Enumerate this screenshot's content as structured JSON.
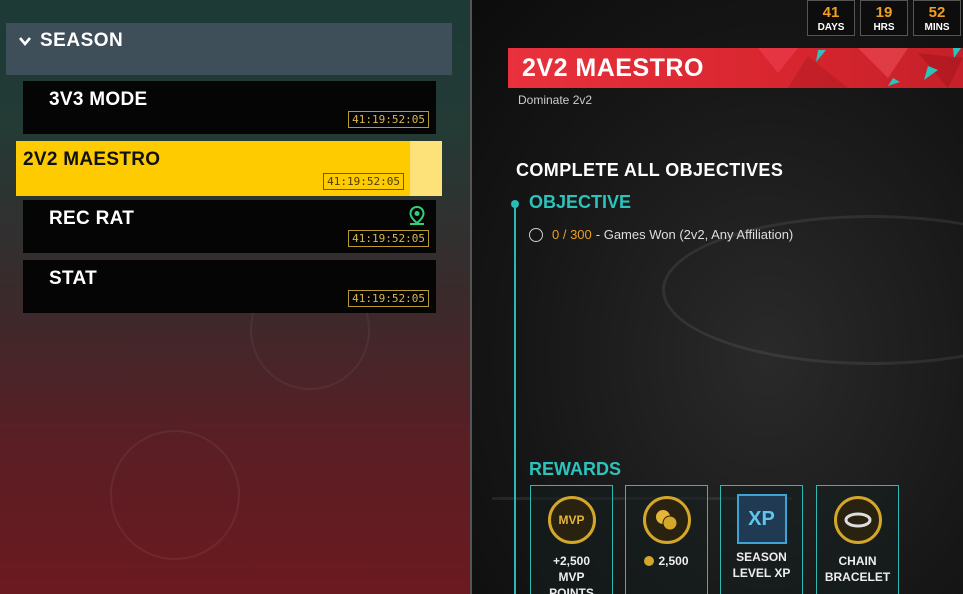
{
  "countdown": [
    {
      "value": "41",
      "unit": "DAYS"
    },
    {
      "value": "19",
      "unit": "HRS"
    },
    {
      "value": "52",
      "unit": "MINS"
    }
  ],
  "sidebar": {
    "section_label": "SEASON",
    "items": [
      {
        "label": "3V3 MODE",
        "timer": "41:19:52:05"
      },
      {
        "label": "2V2 MAESTRO",
        "timer": "41:19:52:05",
        "selected": true
      },
      {
        "label": "REC RAT",
        "timer": "41:19:52:05",
        "icon": "location-pin-icon"
      },
      {
        "label": "STAT",
        "timer": "41:19:52:05"
      }
    ]
  },
  "detail": {
    "title": "2V2 MAESTRO",
    "subtitle": "Dominate 2v2",
    "complete_all": "COMPLETE ALL OBJECTIVES",
    "objective_label": "OBJECTIVE",
    "objective": {
      "progress": "0 / 300",
      "description": "- Games Won (2v2, Any Affiliation)"
    },
    "rewards_label": "REWARDS",
    "rewards": [
      {
        "badge": "MVP",
        "line1": "+2,500",
        "line2": "MVP",
        "line3": "POINTS"
      },
      {
        "line1": "2,500"
      },
      {
        "badge": "XP",
        "line1": "SEASON",
        "line2": "LEVEL XP"
      },
      {
        "line1": "CHAIN",
        "line2": "BRACELET"
      }
    ]
  },
  "colors": {
    "accent_yellow": "#fdcb00",
    "accent_teal": "#2bc3bb",
    "banner_red": "#e8313c",
    "progress_orange": "#e6a025"
  }
}
